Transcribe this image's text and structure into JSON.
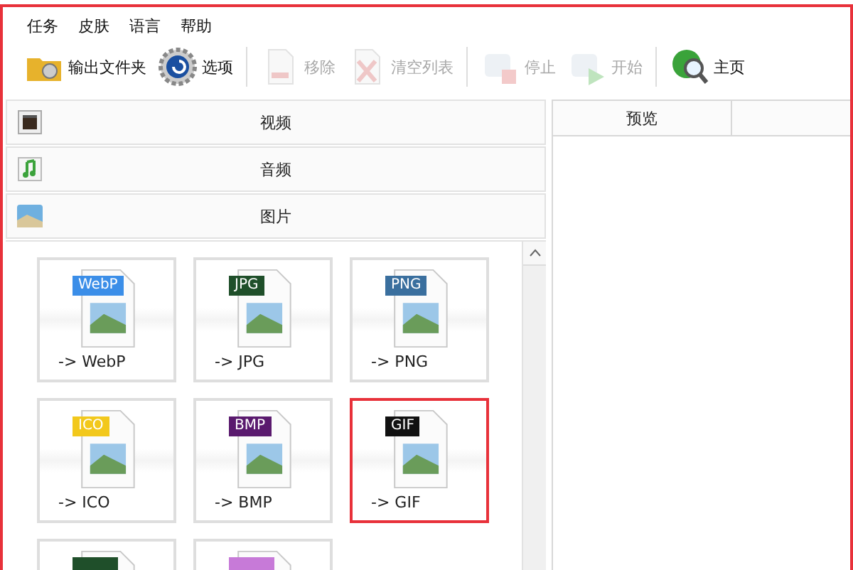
{
  "menu": [
    "任务",
    "皮肤",
    "语言",
    "帮助"
  ],
  "toolbar": [
    {
      "kind": "folder",
      "label": "输出文件夹",
      "disabled": false
    },
    {
      "kind": "gear",
      "label": "选项",
      "disabled": false
    },
    {
      "kind": "sep"
    },
    {
      "kind": "remove",
      "label": "移除",
      "disabled": true
    },
    {
      "kind": "clear",
      "label": "清空列表",
      "disabled": true
    },
    {
      "kind": "sep"
    },
    {
      "kind": "stop",
      "label": "停止",
      "disabled": true
    },
    {
      "kind": "start",
      "label": "开始",
      "disabled": true
    },
    {
      "kind": "sep"
    },
    {
      "kind": "globe",
      "label": "主页",
      "disabled": false
    }
  ],
  "categories": [
    {
      "kind": "video",
      "label": "视频"
    },
    {
      "kind": "audio",
      "label": "音频"
    },
    {
      "kind": "picture",
      "label": "图片"
    }
  ],
  "tiles": [
    {
      "tag": "WebP",
      "label": "-> WebP",
      "color": "#3b8ee8",
      "selected": false
    },
    {
      "tag": "JPG",
      "label": "-> JPG",
      "color": "#1f4f2a",
      "selected": false
    },
    {
      "tag": "PNG",
      "label": "-> PNG",
      "color": "#3a6f9e",
      "selected": false
    },
    {
      "tag": "ICO",
      "label": "-> ICO",
      "color": "#f2c81c",
      "selected": false
    },
    {
      "tag": "BMP",
      "label": "-> BMP",
      "color": "#5a1a6e",
      "selected": false
    },
    {
      "tag": "GIF",
      "label": "-> GIF",
      "color": "#111111",
      "selected": true
    },
    {
      "color": "#1f4f2a",
      "selected": false
    },
    {
      "color": "#c77ad8",
      "selected": false
    }
  ],
  "preview": {
    "column_1": "预览"
  }
}
